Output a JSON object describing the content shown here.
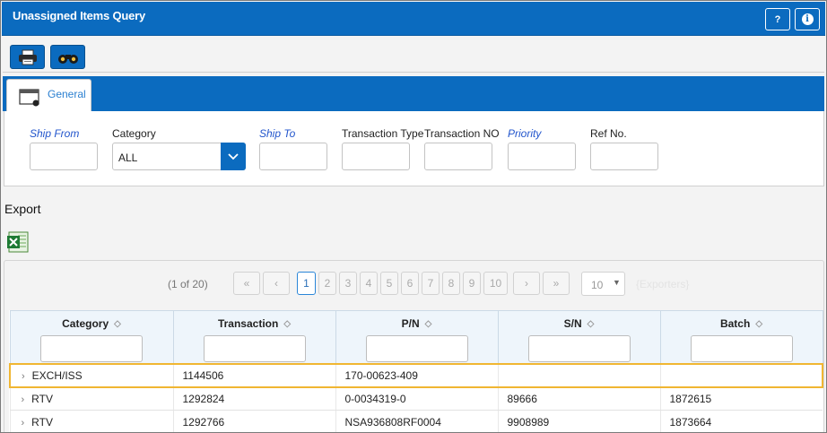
{
  "window": {
    "title": "Unassigned Items Query",
    "help_label": "?",
    "info_label": "i"
  },
  "toolbar": {
    "print_icon": "printer-icon",
    "find_icon": "binoculars-icon"
  },
  "tabs": [
    {
      "label": "General",
      "icon": "window-icon",
      "active": true
    }
  ],
  "filters": {
    "ship_from": {
      "label": "Ship From",
      "value": ""
    },
    "category": {
      "label": "Category",
      "value": "ALL"
    },
    "ship_to": {
      "label": "Ship To",
      "value": ""
    },
    "transaction_type": {
      "label": "Transaction Type",
      "value": ""
    },
    "transaction_no": {
      "label": "Transaction NO",
      "value": ""
    },
    "priority": {
      "label": "Priority",
      "value": ""
    },
    "ref_no": {
      "label": "Ref No.",
      "value": ""
    }
  },
  "export": {
    "label": "Export",
    "excel_icon": "excel-icon"
  },
  "pager": {
    "info": "(1 of 20)",
    "first": "«",
    "prev": "‹",
    "pages": [
      "1",
      "2",
      "3",
      "4",
      "5",
      "6",
      "7",
      "8",
      "9",
      "10"
    ],
    "current_page": "1",
    "next": "›",
    "last": "»",
    "per_page": "10",
    "exporters": "{Exporters}"
  },
  "table": {
    "columns": [
      "Category",
      "Transaction",
      "P/N",
      "S/N",
      "Batch"
    ],
    "rows": [
      {
        "category": "EXCH/ISS",
        "transaction": "1144506",
        "pn": "170-00623-409",
        "sn": "",
        "batch": ""
      },
      {
        "category": "RTV",
        "transaction": "1292824",
        "pn": "0-0034319-0",
        "sn": "89666",
        "batch": "1872615"
      },
      {
        "category": "RTV",
        "transaction": "1292766",
        "pn": "NSA936808RF0004",
        "sn": "9908989",
        "batch": "1873664"
      }
    ]
  },
  "colors": {
    "primary": "#0b6bbf",
    "link": "#2255cc",
    "selection": "#f0b632",
    "header_bg": "#eef5fb"
  }
}
